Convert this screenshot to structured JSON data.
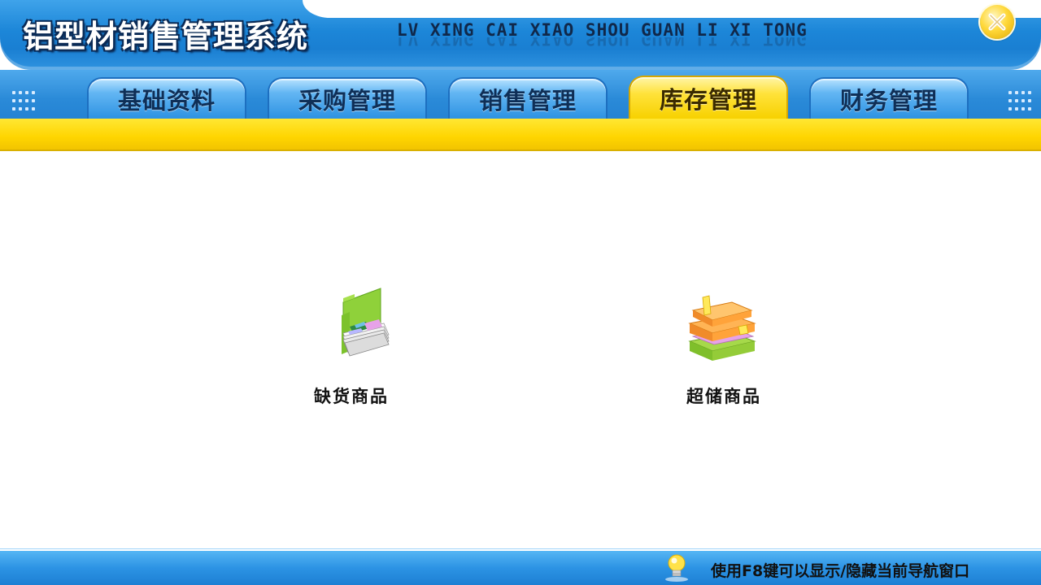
{
  "app": {
    "title": "铝型材销售管理系统",
    "subtitle": "LV XING CAI XIAO SHOU GUAN LI XI TONG"
  },
  "tabs": [
    {
      "label": "基础资料",
      "active": false
    },
    {
      "label": "采购管理",
      "active": false
    },
    {
      "label": "销售管理",
      "active": false
    },
    {
      "label": "库存管理",
      "active": true
    },
    {
      "label": "财务管理",
      "active": false
    }
  ],
  "main": {
    "items": [
      {
        "label": "缺货商品",
        "icon": "folder-documents-icon"
      },
      {
        "label": "超储商品",
        "icon": "stacked-boxes-icon"
      }
    ]
  },
  "footer": {
    "tip": "使用F8键可以显示/隐藏当前导航窗口",
    "icon": "lightbulb-icon"
  },
  "colors": {
    "header_blue": "#1c86d8",
    "tab_active_yellow": "#ffe23a",
    "band_yellow": "#ffd500"
  }
}
